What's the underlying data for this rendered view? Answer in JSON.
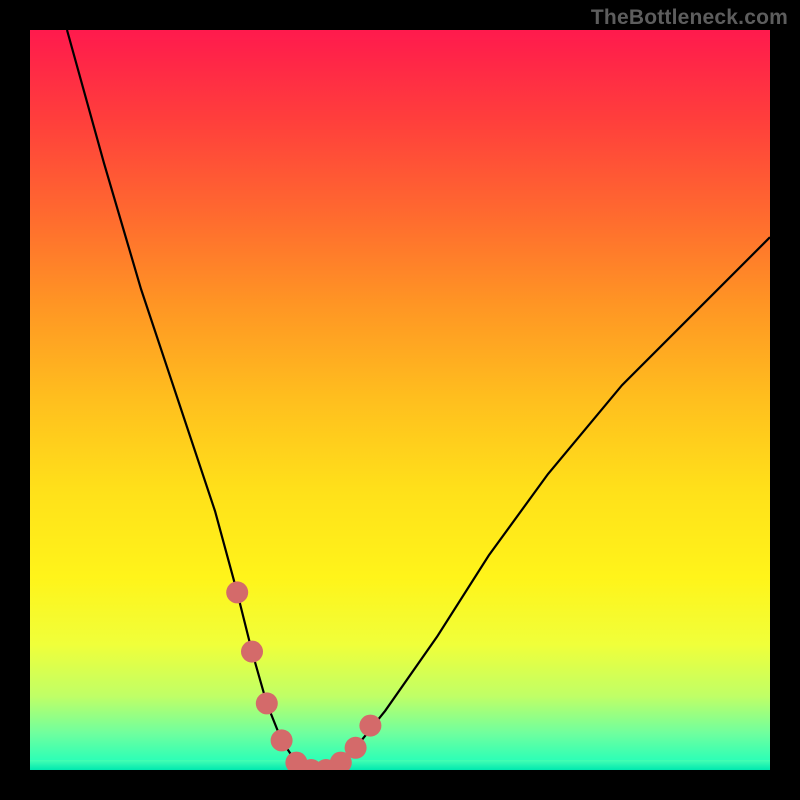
{
  "watermark": "TheBottleneck.com",
  "colors": {
    "frame_bg": "#000000",
    "gradient_top": "#ff1a4d",
    "gradient_bottom": "#15ffbf",
    "curve": "#000000",
    "markers": "#d46a6a"
  },
  "chart_data": {
    "type": "line",
    "title": "",
    "xlabel": "",
    "ylabel": "",
    "xlim": [
      0,
      100
    ],
    "ylim": [
      0,
      100
    ],
    "series": [
      {
        "name": "bottleneck-curve",
        "x": [
          5,
          10,
          15,
          20,
          25,
          28,
          30,
          32,
          34,
          36,
          38,
          40,
          42,
          44,
          48,
          55,
          62,
          70,
          80,
          90,
          100
        ],
        "values": [
          100,
          82,
          65,
          50,
          35,
          24,
          16,
          9,
          4,
          1,
          0,
          0,
          1,
          3,
          8,
          18,
          29,
          40,
          52,
          62,
          72
        ]
      }
    ],
    "markers": {
      "name": "highlight-points",
      "x": [
        28,
        30,
        32,
        34,
        36,
        38,
        40,
        42,
        44,
        46
      ],
      "values": [
        24,
        16,
        9,
        4,
        1,
        0,
        0,
        1,
        3,
        6
      ]
    },
    "annotations": [
      {
        "text": "TheBottleneck.com",
        "position": "top-right"
      }
    ]
  }
}
